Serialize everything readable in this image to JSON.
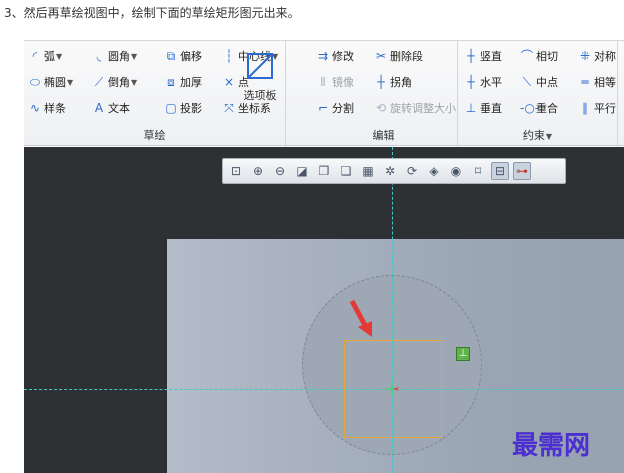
{
  "caption": "3、然后再草绘视图中，绘制下面的草绘矩形图元出来。",
  "ribbon": {
    "sketch_group": {
      "label": "草绘",
      "rows": [
        [
          {
            "label": "弧",
            "icon": "arc-icon",
            "dropdown": true
          },
          {
            "label": "圆角",
            "icon": "fillet-icon",
            "dropdown": true
          },
          {
            "label": "偏移",
            "icon": "offset-icon"
          },
          {
            "label": "中心线",
            "icon": "centerline-icon",
            "dropdown": true
          }
        ],
        [
          {
            "label": "椭圆",
            "icon": "ellipse-icon",
            "dropdown": true
          },
          {
            "label": "倒角",
            "icon": "chamfer-icon",
            "dropdown": true
          },
          {
            "label": "加厚",
            "icon": "thicken-icon"
          },
          {
            "label": "点",
            "icon": "point-icon"
          }
        ],
        [
          {
            "label": "样条",
            "icon": "spline-icon"
          },
          {
            "label": "文本",
            "icon": "text-icon"
          },
          {
            "label": "投影",
            "icon": "project-icon"
          },
          {
            "label": "坐标系",
            "icon": "coordinate-system-icon"
          }
        ]
      ],
      "palette_label": "选项板"
    },
    "edit_group": {
      "label": "编辑",
      "rows": [
        [
          {
            "label": "修改",
            "icon": "modify-icon"
          },
          {
            "label": "删除段",
            "icon": "delete-segment-icon"
          }
        ],
        [
          {
            "label": "镜像",
            "icon": "mirror-icon",
            "disabled": true
          },
          {
            "label": "拐角",
            "icon": "corner-icon"
          }
        ],
        [
          {
            "label": "分割",
            "icon": "divide-icon"
          },
          {
            "label": "旋转调整大小",
            "icon": "rotate-resize-icon",
            "disabled": true
          }
        ]
      ]
    },
    "constrain_group": {
      "label": "约束",
      "rows": [
        [
          {
            "label": "竖直",
            "icon": "vertical-icon"
          },
          {
            "label": "相切",
            "icon": "tangent-icon"
          },
          {
            "label": "对称",
            "icon": "symmetric-icon"
          }
        ],
        [
          {
            "label": "水平",
            "icon": "horizontal-icon"
          },
          {
            "label": "中点",
            "icon": "midpoint-icon"
          },
          {
            "label": "相等",
            "icon": "equal-icon"
          }
        ],
        [
          {
            "label": "垂直",
            "icon": "perpendicular-icon"
          },
          {
            "label": "重合",
            "icon": "coincident-icon"
          },
          {
            "label": "平行",
            "icon": "parallel-icon"
          }
        ]
      ]
    }
  },
  "view_toolbar": [
    "refit-icon",
    "zoom-in-icon",
    "zoom-out-icon",
    "repaint-icon",
    "display-style-icon",
    "saved-views-icon",
    "view-manager-icon",
    "datum-display-icon",
    "spin-center-icon",
    "annotation-display-icon",
    "sketch-view-icon",
    "sketcher-display-icon",
    "constraint-display-icon",
    "vertex-display-icon"
  ],
  "constraint_badge": "⊥",
  "watermark": "最需网",
  "colors": {
    "sketch_rect": "#e7a63a",
    "centerline": "#43c7c9",
    "arrow": "#e53935",
    "watermark": "#4b2fd0"
  }
}
